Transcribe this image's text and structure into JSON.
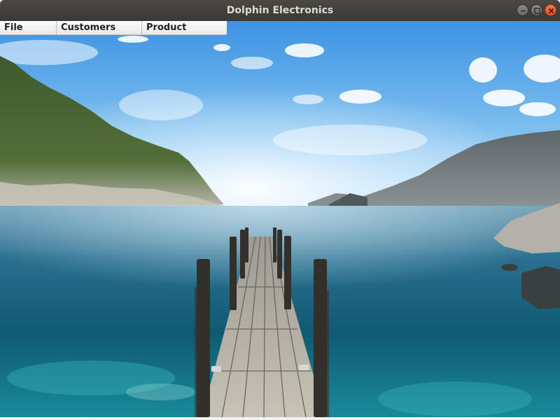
{
  "window": {
    "title": "Dolphin Electronics",
    "controls": {
      "minimize": "minimize",
      "maximize": "maximize",
      "close": "close"
    }
  },
  "menubar": {
    "items": [
      {
        "label": "File"
      },
      {
        "label": "Customers"
      },
      {
        "label": "Product"
      }
    ]
  },
  "background": {
    "icon": "scenic-lake-pier-photo"
  }
}
